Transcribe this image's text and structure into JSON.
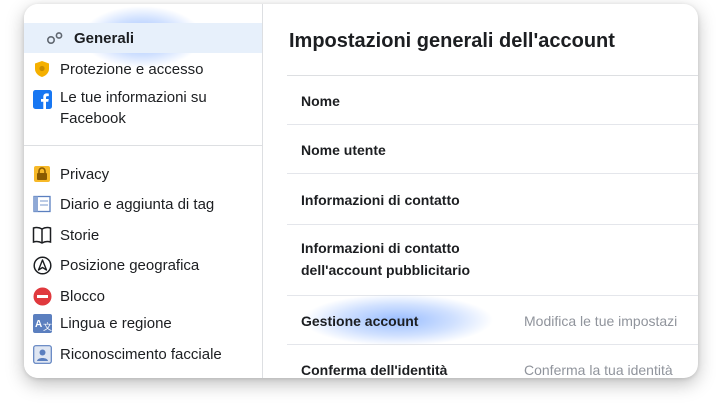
{
  "sidebar": {
    "items": [
      {
        "label": "Generali",
        "icon": "gears-icon",
        "active": true
      },
      {
        "label": "Protezione e accesso",
        "icon": "shield-icon"
      },
      {
        "label": "Le tue informazioni su Facebook",
        "icon": "facebook-icon"
      },
      {
        "label": "Privacy",
        "icon": "lock-icon"
      },
      {
        "label": "Diario e aggiunta di tag",
        "icon": "timeline-icon"
      },
      {
        "label": "Storie",
        "icon": "book-icon"
      },
      {
        "label": "Posizione geografica",
        "icon": "location-icon"
      },
      {
        "label": "Blocco",
        "icon": "block-icon"
      },
      {
        "label": "Lingua e regione",
        "icon": "language-icon"
      },
      {
        "label": "Riconoscimento facciale",
        "icon": "face-recognition-icon"
      }
    ]
  },
  "main": {
    "title": "Impostazioni generali dell'account",
    "rows": [
      {
        "label": "Nome",
        "value": ""
      },
      {
        "label": "Nome utente",
        "value": ""
      },
      {
        "label": "Informazioni di contatto",
        "value": ""
      },
      {
        "label": "Informazioni di contatto dell'account pubblicitario",
        "value": ""
      },
      {
        "label": "Gestione account",
        "value": "Modifica le tue impostazi"
      },
      {
        "label": "Conferma dell'identità",
        "value": "Conferma la tua identità"
      }
    ]
  },
  "colors": {
    "accent": "#1877f2",
    "active_bg": "#e7f0fb",
    "highlight_glow": "#4687ff",
    "text": "#1c1e21",
    "muted": "#90949c"
  }
}
